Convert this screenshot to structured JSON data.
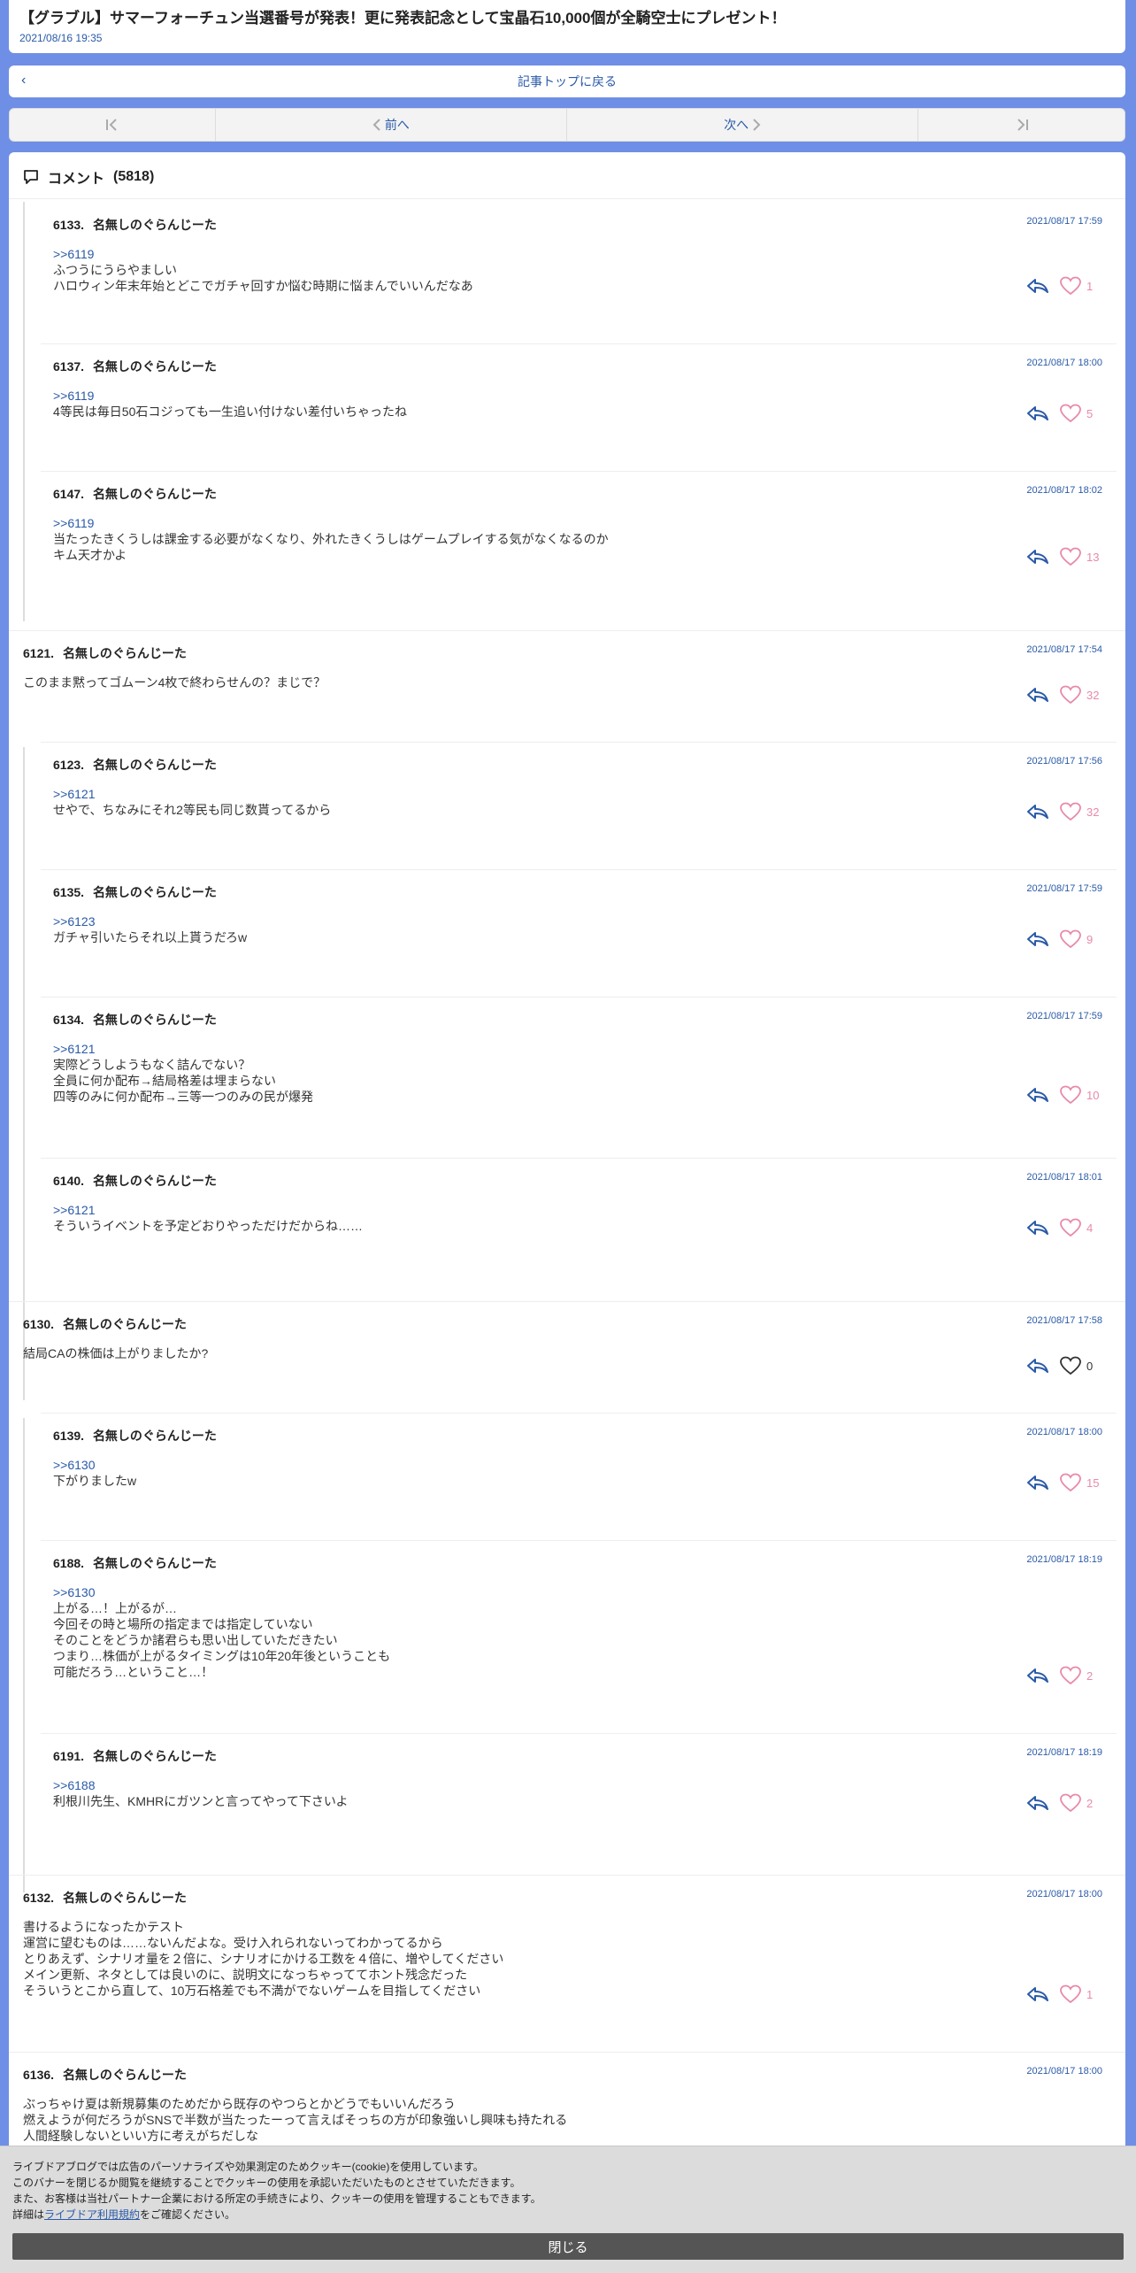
{
  "article": {
    "title": "【グラブル】サマーフォーチュン当選番号が発表！更に発表記念として宝晶石10,000個が全騎空士にプレゼント！",
    "date": "2021/08/16 19:35"
  },
  "nav": {
    "back_label": "記事トップに戻る",
    "prev_label": "前へ",
    "next_label": "次へ"
  },
  "comments_section": {
    "header_label": "コメント",
    "count": "(5818)"
  },
  "comments": [
    {
      "id": "c6133",
      "no": "6133.",
      "name": "名無しのぐらんじーた",
      "time": "2021/08/17 17:59",
      "anchor": ">>6119",
      "lines": [
        "ふつうにうらやましい",
        "ハロウィン年末年始とどこでガチャ回すか悩む時期に悩まんでいいんだなあ"
      ],
      "likes": "1"
    },
    {
      "id": "c6137",
      "no": "6137.",
      "name": "名無しのぐらんじーた",
      "time": "2021/08/17 18:00",
      "anchor": ">>6119",
      "lines": [
        "4等民は毎日50石コジっても一生追い付けない差付いちゃったね"
      ],
      "likes": "5"
    },
    {
      "id": "c6147",
      "no": "6147.",
      "name": "名無しのぐらんじーた",
      "time": "2021/08/17 18:02",
      "anchor": ">>6119",
      "lines": [
        "当たったきくうしは課金する必要がなくなり、外れたきくうしはゲームプレイする気がなくなるのか",
        "キム天才かよ"
      ],
      "likes": "13"
    },
    {
      "id": "c6121",
      "no": "6121.",
      "name": "名無しのぐらんじーた",
      "time": "2021/08/17 17:54",
      "anchor": "",
      "lines": [
        "このまま黙ってゴムーン4枚で終わらせんの？まじで？"
      ],
      "likes": "32"
    },
    {
      "id": "c6123",
      "no": "6123.",
      "name": "名無しのぐらんじーた",
      "time": "2021/08/17 17:56",
      "anchor": ">>6121",
      "lines": [
        "せやで、ちなみにそれ2等民も同じ数貰ってるから"
      ],
      "likes": "32"
    },
    {
      "id": "c6135",
      "no": "6135.",
      "name": "名無しのぐらんじーた",
      "time": "2021/08/17 17:59",
      "anchor": ">>6123",
      "lines": [
        "ガチャ引いたらそれ以上貰うだろw"
      ],
      "likes": "9"
    },
    {
      "id": "c6134",
      "no": "6134.",
      "name": "名無しのぐらんじーた",
      "time": "2021/08/17 17:59",
      "anchor": ">>6121",
      "lines": [
        "実際どうしようもなく詰んでない？",
        "全員に何か配布→結局格差は埋まらない",
        "四等のみに何か配布→三等一つのみの民が爆発"
      ],
      "likes": "10"
    },
    {
      "id": "c6140",
      "no": "6140.",
      "name": "名無しのぐらんじーた",
      "time": "2021/08/17 18:01",
      "anchor": ">>6121",
      "lines": [
        "そういうイベントを予定どおりやっただけだからね……"
      ],
      "likes": "4"
    },
    {
      "id": "c6130",
      "no": "6130.",
      "name": "名無しのぐらんじーた",
      "time": "2021/08/17 17:58",
      "anchor": "",
      "lines": [
        "結局CAの株価は上がりましたか?"
      ],
      "likes": "0"
    },
    {
      "id": "c6139",
      "no": "6139.",
      "name": "名無しのぐらんじーた",
      "time": "2021/08/17 18:00",
      "anchor": ">>6130",
      "lines": [
        "下がりましたw"
      ],
      "likes": "15"
    },
    {
      "id": "c6188",
      "no": "6188.",
      "name": "名無しのぐらんじーた",
      "time": "2021/08/17 18:19",
      "anchor": ">>6130",
      "lines": [
        "上がる…！上がるが…",
        "今回その時と場所の指定までは指定していない",
        "そのことをどうか諸君らも思い出していただきたい",
        "つまり…株価が上がるタイミングは10年20年後ということも",
        "可能だろう…ということ…！"
      ],
      "likes": "2"
    },
    {
      "id": "c6191",
      "no": "6191.",
      "name": "名無しのぐらんじーた",
      "time": "2021/08/17 18:19",
      "anchor": ">>6188",
      "lines": [
        "利根川先生、KMHRにガツンと言ってやって下さいよ"
      ],
      "likes": "2"
    },
    {
      "id": "c6132",
      "no": "6132.",
      "name": "名無しのぐらんじーた",
      "time": "2021/08/17 18:00",
      "anchor": "",
      "lines": [
        "書けるようになったかテスト",
        "運営に望むものは……ないんだよな。受け入れられないってわかってるから",
        "とりあえず、シナリオ量を２倍に、シナリオにかける工数を４倍に、増やしてください",
        "メイン更新、ネタとしては良いのに、説明文になっちゃっててホント残念だった",
        "そういうとこから直して、10万石格差でも不満がでないゲームを目指してください"
      ],
      "likes": "1"
    },
    {
      "id": "c6136",
      "no": "6136.",
      "name": "名無しのぐらんじーた",
      "time": "2021/08/17 18:00",
      "anchor": "",
      "lines": [
        "ぶっちゃけ夏は新規募集のためだから既存のやつらとかどうでもいいんだろう",
        "燃えようが何だろうがSNSで半数が当たったーって言えばそっちの方が印象強いし興味も持たれる",
        "人間経験しないといい方に考えがちだしな"
      ],
      "likes": ""
    }
  ],
  "cookie_banner": {
    "line1": "ライブドアブログでは広告のパーソナライズや効果測定のためクッキー(cookie)を使用しています。",
    "line2": "このバナーを閉じるか閲覧を継続することでクッキーの使用を承認いただいたものとさせていただきます。",
    "line3": "また、お客様は当社パートナー企業における所定の手続きにより、クッキーの使用を管理することもできます。",
    "line4_prefix": "詳細は",
    "line4_link": "ライブドア利用規約",
    "line4_suffix": "をご確認ください。",
    "close_label": "閉じる"
  },
  "colors": {
    "page_bg": "#6f8fe6",
    "link": "#2a5aa8",
    "like": "#e88aa8"
  }
}
